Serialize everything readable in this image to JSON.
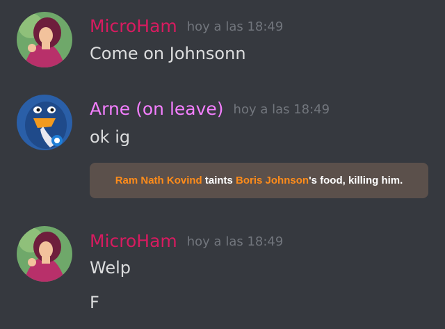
{
  "messages": [
    {
      "author": "MicroHam",
      "author_color": "#d81b60",
      "timestamp": "hoy a las 18:49",
      "avatar_icon": "hercules-megara-avatar-icon",
      "lines": [
        "Come on Johnsonn"
      ]
    },
    {
      "author": "Arne (on leave)",
      "author_color": "#f47fff",
      "timestamp": "hoy a las 18:49",
      "avatar_icon": "penguin-avatar-icon",
      "lines": [
        "ok ig"
      ],
      "embed": {
        "actor": "Ram Nath Kovind",
        "verb": " taints ",
        "target": "Boris Johnson",
        "rest": "'s food, killing him.",
        "name_color": "#ff8c1a"
      }
    },
    {
      "author": "MicroHam",
      "author_color": "#d81b60",
      "timestamp": "hoy a las 18:49",
      "avatar_icon": "hercules-megara-avatar-icon",
      "lines": [
        "Welp",
        "F"
      ]
    }
  ]
}
